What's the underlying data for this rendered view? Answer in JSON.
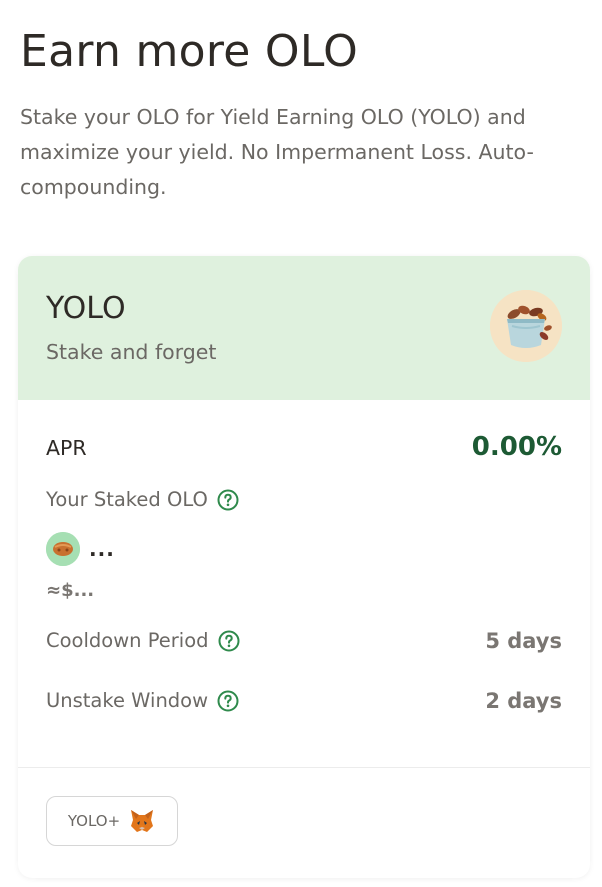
{
  "header": {
    "title": "Earn more OLO",
    "subtitle": "Stake your OLO for Yield Earning OLO (YOLO) and maximize your yield. No Impermanent Loss. Auto-compounding."
  },
  "card": {
    "title": "YOLO",
    "subtitle": "Stake and forget",
    "token_icon": "olo-bucket-icon",
    "apr": {
      "label": "APR",
      "value": "0.00%"
    },
    "staked": {
      "label": "Your Staked OLO",
      "amount": "...",
      "usd": "≈$...",
      "icon": "olo-token-icon"
    },
    "cooldown": {
      "label": "Cooldown Period",
      "value": "5 days"
    },
    "unstake_window": {
      "label": "Unstake Window",
      "value": "2 days"
    },
    "add_token_button": {
      "label": "YOLO+",
      "icon": "metamask-fox-icon"
    }
  },
  "colors": {
    "header_background": "#dff1de",
    "apr_value": "#1d5a34",
    "help_icon": "#2f8a4c",
    "page_text": "#2e2a26",
    "muted_text": "#6b6864"
  }
}
